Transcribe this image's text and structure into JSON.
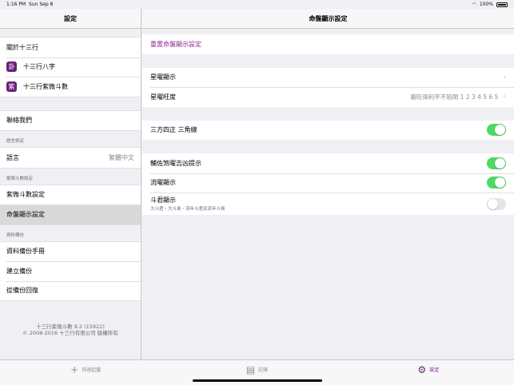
{
  "status": {
    "time": "1:16 PM",
    "date": "Sun Sep 8",
    "battery": "100%"
  },
  "sidebar": {
    "title": "設定",
    "group1": [
      {
        "label": "關於十三行"
      },
      {
        "label": "十三行八字",
        "icon": "卦"
      },
      {
        "label": "十三行紫微斗數",
        "icon": "紫"
      }
    ],
    "contact": "聯絡我們",
    "lang_header": "語言設定",
    "lang_label": "語言",
    "lang_value": "繁體中文",
    "ziwei_header": "紫微斗數設定",
    "ziwei_items": [
      "紫微斗數設定",
      "命盤顯示設定"
    ],
    "backup_header": "資料備份",
    "backup_items": [
      "資料備份手冊",
      "建立備份",
      "從備份回復"
    ],
    "footer_line1": "十三行紫微斗數 9.2 (15922)",
    "footer_line2": "© 2008-2016 十三行有限公司 版權所有"
  },
  "main": {
    "title": "命盤顯示設定",
    "reset": "重置命盤顯示設定",
    "star_display": "星曜顯示",
    "star_strength": "星曜旺度",
    "star_strength_value": "廟旺得利平不陷閑 1 2 3 4 5 6 5",
    "sanfang": "三方四正 三角線",
    "fuzuo": "輔佐煞曜吉凶提示",
    "liuyao": "流曜顯示",
    "doujun": "斗君顯示",
    "doujun_sub": "大斗君・大斗島・流年斗君及流年斗島"
  },
  "tabs": [
    {
      "label": "快速起盤",
      "icon": "plus-icon"
    },
    {
      "label": "記錄",
      "icon": "records-icon"
    },
    {
      "label": "設定",
      "icon": "gear-icon"
    }
  ],
  "colors": {
    "accent": "#8e2a91",
    "toggle_on": "#4cd964"
  }
}
